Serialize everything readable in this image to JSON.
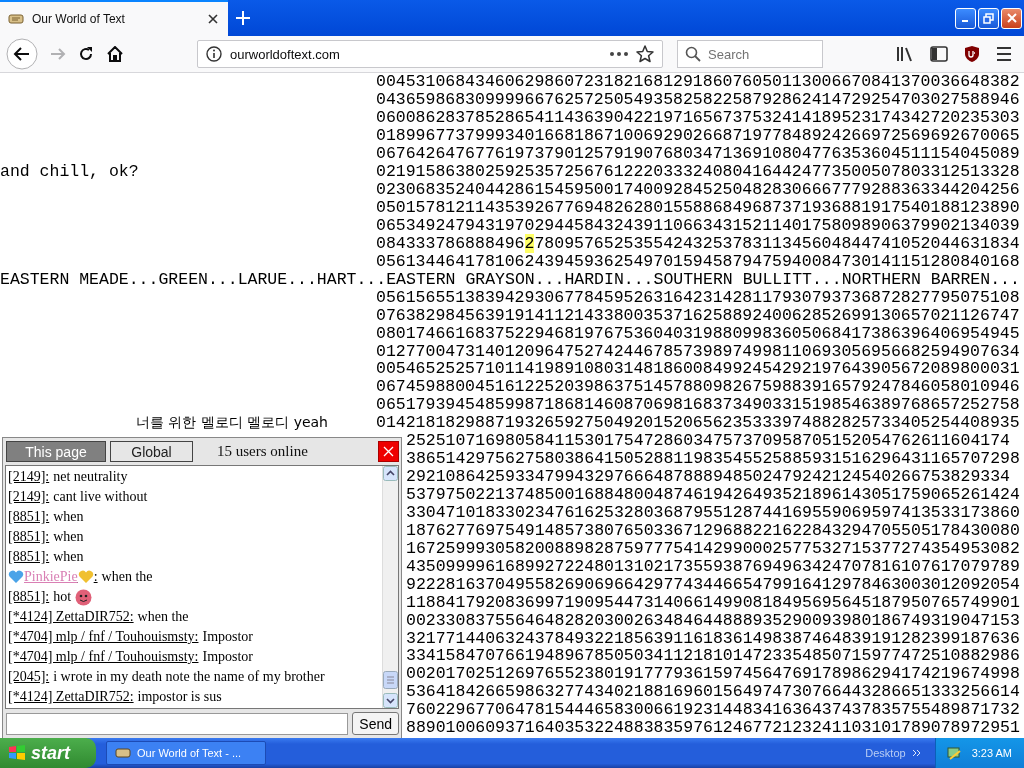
{
  "browser": {
    "tab_title": "Our World of Text",
    "url": "ourworldoftext.com",
    "search_placeholder": "Search",
    "back_enabled": true,
    "forward_enabled": false
  },
  "world": {
    "rows": [
      {
        "segments": [
          {
            "text": "00453106843460629860723182168129186076050113006670841370036648382",
            "highlighted": false
          }
        ]
      },
      {
        "segments": [
          {
            "text": "04365986830999966762572505493582582258792862414729254703027588946",
            "highlighted": false
          }
        ]
      },
      {
        "segments": [
          {
            "text": "06008628378528654114363904221971656737532414189523174342720235303",
            "highlighted": false
          }
        ]
      },
      {
        "segments": [
          {
            "text": "01899677379993401668186710069290266871977848924266972569692670065",
            "highlighted": false
          }
        ]
      },
      {
        "segments": [
          {
            "text": "06764264767761973790125791907680347136910804776353604511154045089",
            "highlighted": false
          }
        ]
      },
      {
        "left": "and chill, ok?",
        "kind": "left-note",
        "segments": [
          {
            "text": "02191586380259253572567612220333240804164424773500507803312513328",
            "highlighted": false
          }
        ]
      },
      {
        "segments": [
          {
            "text": "02306835240442861545950017400928452504828306667779288363344204256",
            "highlighted": false
          }
        ]
      },
      {
        "segments": [
          {
            "text": "05015781211435392677694826280155886849687371936881917540188123890",
            "highlighted": false
          }
        ]
      },
      {
        "segments": [
          {
            "text": "06534924794319702944584324391106634315211401758098906379902134039",
            "highlighted": false
          }
        ]
      },
      {
        "segments": [
          {
            "text": "084333786888496",
            "highlighted": false
          },
          {
            "text": "2",
            "highlighted": true
          },
          {
            "text": "7809576525355424325378311345604844741052044631834",
            "highlighted": false
          }
        ]
      },
      {
        "segments": [
          {
            "text": "05613446417810624394593625497015945879475940084730141151280840168",
            "highlighted": false
          }
        ]
      },
      {
        "left": "EASTERN MEADE...GREEN...LARUE...HART...",
        "kind": "left-note",
        "segments": [
          {
            "text": "EASTERN GRAYSON...HARDIN...SOUTHERN BULLITT...NORTHERN BARREN...",
            "highlighted": false
          }
        ]
      },
      {
        "segments": [
          {
            "text": "05615655138394293067784595263164231428117930793736872827795075108",
            "highlighted": false
          }
        ]
      },
      {
        "segments": [
          {
            "text": "07638298456391914112143380035371625889240062852699130657021126747",
            "highlighted": false
          }
        ]
      },
      {
        "segments": [
          {
            "text": "08017466168375229468197675360403198809983605068417386396406954945",
            "highlighted": false
          }
        ]
      },
      {
        "segments": [
          {
            "text": "01277004731401209647527424467857398974998110693056956682594907634",
            "highlighted": false
          }
        ]
      },
      {
        "segments": [
          {
            "text": "00546525257101141989108031481860084992454292197643905672089800031",
            "highlighted": false
          }
        ]
      },
      {
        "segments": [
          {
            "text": "06745988004516122520398637514578809826759883916579247846058010946",
            "highlighted": false
          }
        ]
      },
      {
        "segments": [
          {
            "text": "06517939454859987186814608706981683734903315198546389768657252758",
            "highlighted": false
          }
        ]
      },
      {
        "left": "너를 위한 멜로디 멜로디 yeah",
        "kind": "right-note",
        "segments": [
          {
            "text": "01421818298871932659275049201520656235333974882825733405254408935",
            "highlighted": false
          }
        ]
      }
    ],
    "rows_beside_chat": [
      "2525107169805841153017547286034757370958705152054762611604174",
      "38651429756275803864150528811983545525885931516296431165707298",
      "2921086425933479943297666487888948502479242124540266753829334",
      "53797502213748500168848004874619426493521896143051759065261424",
      "33047101833023476162532803687955128744169559069597413533173860",
      "18762776975491485738076503367129688221622843294705505178430080",
      "16725999305820088982875977754142990002577532715377274354953082",
      "43509999616899272248013102173559387694963424707816107617079789",
      "92228163704955826906966429774344665479916412978463003012092054",
      "11884179208369971909544731406614990818495695645187950765749901",
      "00233083755646482820300263484644888935290093980186749319047153",
      "32177144063243784932218563911618361498387464839191282399187636",
      "33415847076619489678505034112181014723354850715977472510882986",
      "00201702512697655238019177793615974564769178986294174219674998",
      "53641842665986327743402188169601564974730766443286651333256614",
      "76022967706478154446583006619231448341636437437835755489871732",
      "88901006093716403532248838359761246772123241103101789078972951"
    ]
  },
  "chat": {
    "tabs": [
      {
        "label": "This page",
        "selected": true
      },
      {
        "label": "Global",
        "selected": false
      }
    ],
    "online": "15 users online",
    "messages": [
      {
        "kind": "plain",
        "user": "[2149]:",
        "text": "net neutrality"
      },
      {
        "kind": "plain",
        "user": "[2149]:",
        "text": "cant live without"
      },
      {
        "kind": "plain",
        "user": "[8851]:",
        "text": "when"
      },
      {
        "kind": "plain",
        "user": "[8851]:",
        "text": "when"
      },
      {
        "kind": "plain",
        "user": "[8851]:",
        "text": "when"
      },
      {
        "kind": "decorated",
        "user": "PinkiePie",
        "separator": ":",
        "text": "when the",
        "color": "#d97fb4"
      },
      {
        "kind": "emoji",
        "user": "[8851]:",
        "text": "hot"
      },
      {
        "kind": "plain",
        "user": "[*4124] ZettaDIR752:",
        "text": "when the"
      },
      {
        "kind": "plain",
        "user": "[*4704] mlp / fnf / Touhouismsty:",
        "text": "Impostor"
      },
      {
        "kind": "plain",
        "user": "[*4704] mlp / fnf / Touhouismsty:",
        "text": "Impostor"
      },
      {
        "kind": "plain",
        "user": "[2045]:",
        "text": "i wrote in my death note the name of my brother"
      },
      {
        "kind": "plain",
        "user": "[*4124] ZettaDIR752:",
        "text": "impostor is sus"
      }
    ],
    "send": "Send"
  },
  "taskbar": {
    "start": "start",
    "task": "Our World of Text - ...",
    "desktop": "Desktop",
    "clock": "3:23 AM"
  }
}
